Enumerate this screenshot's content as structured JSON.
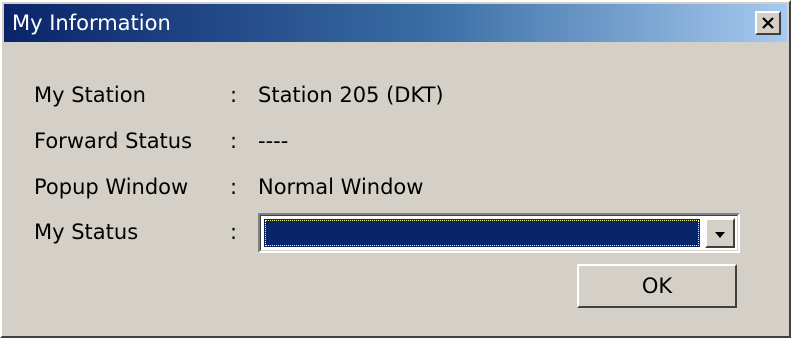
{
  "window": {
    "title": "My Information",
    "close_glyph": "×"
  },
  "fields": [
    {
      "label": "My Station",
      "colon": ":",
      "value": "Station 205 (DKT)"
    },
    {
      "label": "Forward Status",
      "colon": ":",
      "value": "----"
    },
    {
      "label": "Popup Window",
      "colon": ":",
      "value": "Normal Window"
    },
    {
      "label": "My Status",
      "colon": ":",
      "value": ""
    }
  ],
  "status_combo": {
    "selected": ""
  },
  "buttons": {
    "ok_label": "OK"
  },
  "colors": {
    "title_gradient_start": "#0a246a",
    "title_gradient_end": "#a6caf0",
    "dialog_face": "#d4d0c8",
    "selection": "#0a246a"
  },
  "icons": {
    "close": "close-icon",
    "dropdown": "chevron-down-icon"
  }
}
